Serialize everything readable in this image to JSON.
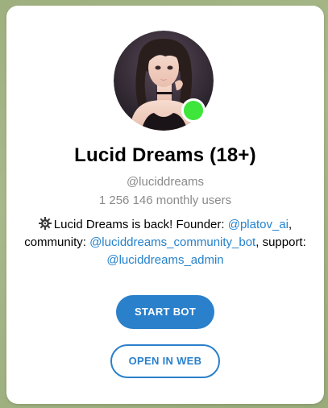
{
  "bot": {
    "name": "Lucid Dreams (18+)",
    "username": "@luciddreams",
    "monthly_users": "1 256 146 monthly users",
    "online": true
  },
  "description": {
    "icon": "gear-icon",
    "text_1": "Lucid Dreams is back! Founder: ",
    "founder_link": "@platov_ai",
    "text_2": ", community: ",
    "community_link": "@luciddreams_community_bot",
    "text_3": ", support: ",
    "support_link": "@luciddreams_admin"
  },
  "buttons": {
    "start_label": "START BOT",
    "web_label": "OPEN IN WEB"
  },
  "colors": {
    "accent": "#2a80cb",
    "link": "#2481cc",
    "online": "#3ee53a",
    "muted_text": "#8a8a8a",
    "background": "#a2b383"
  }
}
